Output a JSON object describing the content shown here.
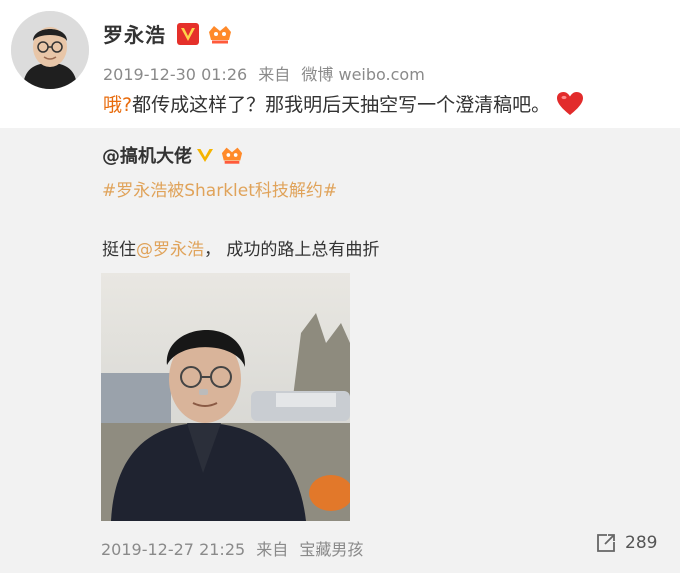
{
  "post": {
    "author": "罗永浩",
    "timestamp": "2019-12-30 01:26",
    "source_prefix": "来自",
    "source": "微博 weibo.com",
    "text_highlight": "哦?",
    "text_body": " 都传成这样了？那我明后天抽空写一个澄清稿吧。",
    "avatar_icon": "avatar-person-glasses",
    "verified_icon": "verified-v-icon",
    "member_icon": "member-crown-icon",
    "emoji_icon": "heart-icon"
  },
  "repost": {
    "author": "@搞机大佬",
    "topic": "#罗永浩被Sharklet科技解约#",
    "text_prefix": "挺住",
    "mention": "@罗永浩",
    "text_suffix": "， 成功的路上总有曲折",
    "timestamp": "2019-12-27 21:25",
    "source_prefix": "来自",
    "source": "宝藏男孩",
    "share_count": "289",
    "share_icon": "share-icon"
  },
  "colors": {
    "accent_orange": "#e86b0c",
    "topic_color": "#e0a35a",
    "repost_bg": "#f2f2f2",
    "meta_gray": "#8a8a8a"
  }
}
